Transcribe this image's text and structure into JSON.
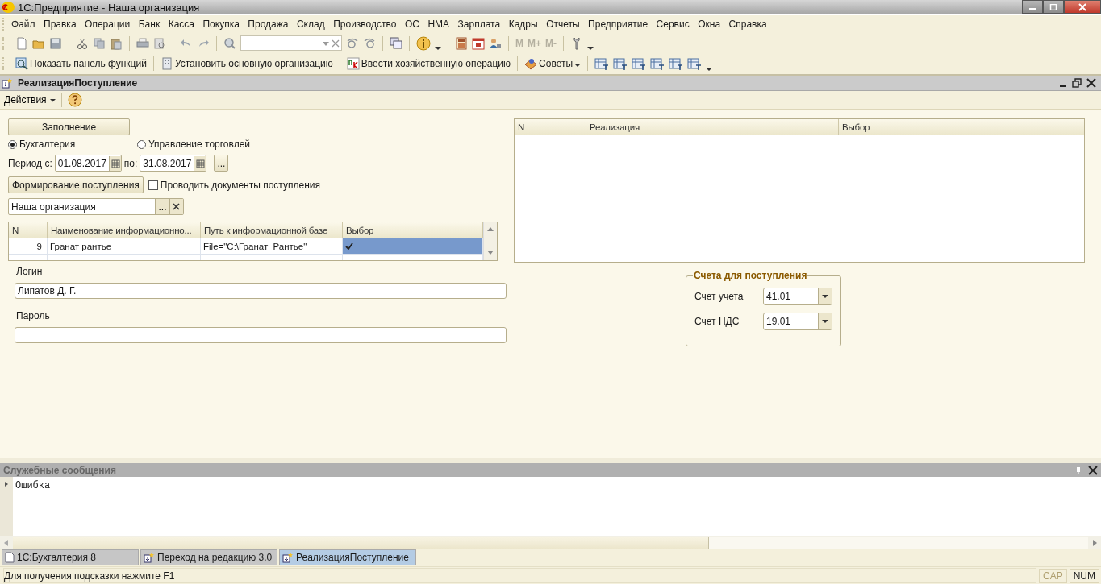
{
  "window": {
    "title": "1С:Предприятие - Наша организация"
  },
  "menu": [
    "Файл",
    "Правка",
    "Операции",
    "Банк",
    "Касса",
    "Покупка",
    "Продажа",
    "Склад",
    "Производство",
    "ОС",
    "НМА",
    "Зарплата",
    "Кадры",
    "Отчеты",
    "Предприятие",
    "Сервис",
    "Окна",
    "Справка"
  ],
  "toolbar": {
    "memory_buttons": [
      "M",
      "M+",
      "M-"
    ]
  },
  "function_bar": [
    {
      "label": "Показать панель функций",
      "kind": "panel"
    },
    {
      "label": "Установить основную организацию",
      "kind": "org"
    },
    {
      "label": "Ввести хозяйственную операцию",
      "kind": "operation"
    },
    {
      "label": "Советы",
      "kind": "tips"
    }
  ],
  "document": {
    "title": "РеализацияПоступление",
    "actions": "Действия"
  },
  "form": {
    "fill_button": "Заполнение",
    "modes": [
      {
        "label": "Бухгалтерия",
        "selected": true
      },
      {
        "label": "Управление торговлей",
        "selected": false
      }
    ],
    "period": {
      "from_label": "Период с:",
      "from": "01.08.2017",
      "to_label": "по:",
      "to": "31.08.2017",
      "more_button": "..."
    },
    "form_button": "Формирование поступления",
    "post_documents": {
      "label": "Проводить документы поступления",
      "checked": false
    },
    "organization": {
      "value": "Наша организация",
      "select_button": "..."
    },
    "bases_table": {
      "columns": [
        "N",
        "Наименование информационно...",
        "Путь к информационной базе",
        "Выбор"
      ],
      "rows": [
        {
          "n": "9",
          "name": "Гранат рантье",
          "path": "File=\"C:\\Гранат_Рантье\"",
          "checked": true,
          "selected": true
        }
      ]
    },
    "login": {
      "label": "Логин",
      "value": "Липатов Д. Г."
    },
    "password": {
      "label": "Пароль"
    },
    "sales_table": {
      "columns": [
        "N",
        "Реализация",
        "Выбор"
      ]
    },
    "accounts": {
      "title": "Счета для поступления",
      "fields": [
        {
          "label": "Счет учета",
          "value": "41.01"
        },
        {
          "label": "Счет НДС",
          "value": "19.01"
        }
      ]
    }
  },
  "messages": {
    "title": "Служебные сообщения",
    "items": [
      "Ошибка"
    ]
  },
  "taskbar": [
    {
      "label": "1С:Бухгалтерия 8",
      "kind": "main",
      "selected": false
    },
    {
      "label": "Переход на редакцию 3.0",
      "kind": "form",
      "selected": false
    },
    {
      "label": "РеализацияПоступление",
      "kind": "form",
      "selected": true
    }
  ],
  "status_bar": {
    "hint": "Для получения подсказки нажмите F1",
    "indicators": [
      {
        "label": "CAP",
        "on": false
      },
      {
        "label": "NUM",
        "on": true
      }
    ]
  }
}
